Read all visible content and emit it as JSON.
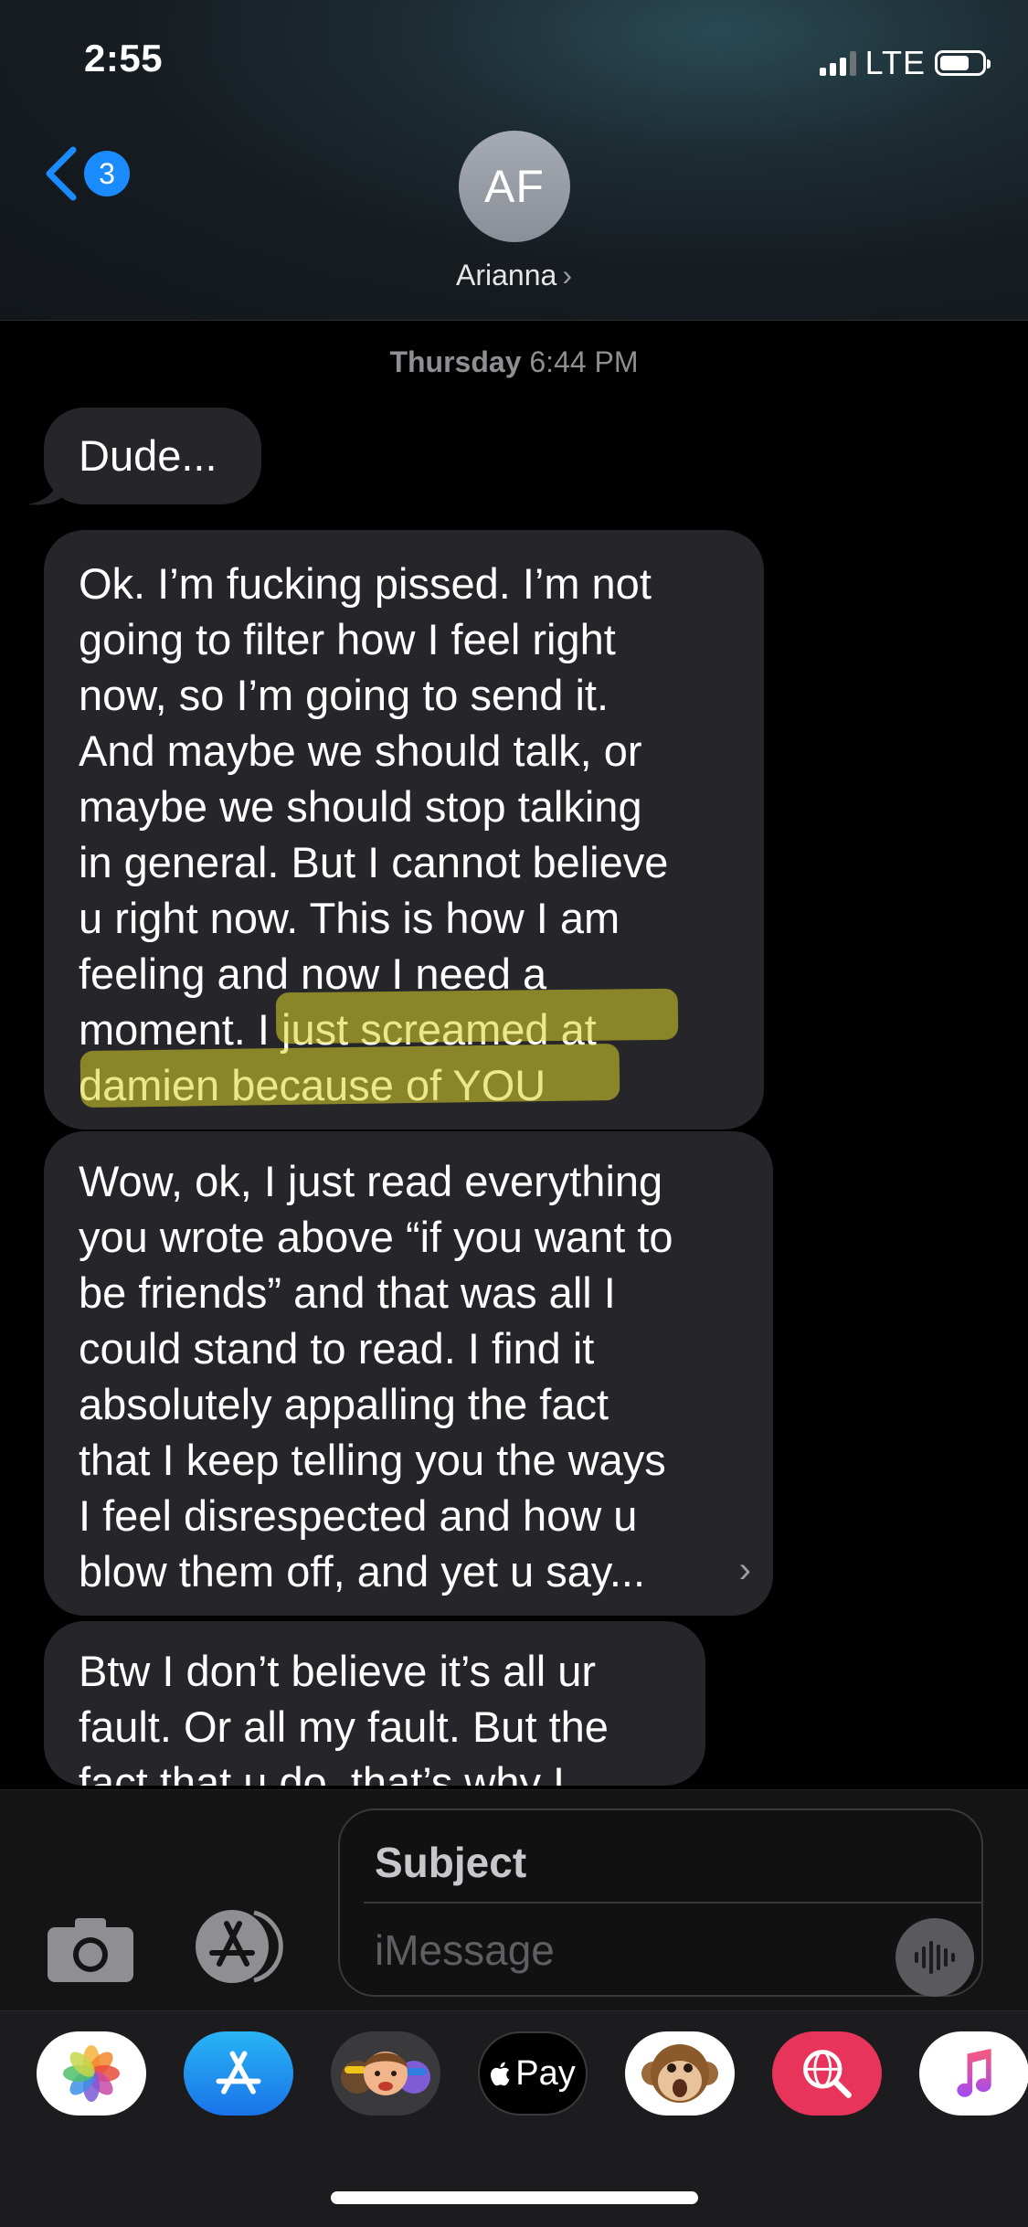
{
  "status": {
    "time": "2:55",
    "network": "LTE"
  },
  "nav": {
    "unread_count": "3",
    "avatar_initials": "AF",
    "contact_name": "Arianna"
  },
  "conversation": {
    "timestamp_day": "Thursday",
    "timestamp_time": "6:44 PM",
    "messages": [
      {
        "lines": [
          "Dude..."
        ]
      },
      {
        "lines": [
          "Ok. I’m fucking pissed. I’m not",
          "going to filter how I feel right",
          "now, so I’m going to send it.",
          "And maybe we should talk, or",
          "maybe we should stop talking",
          "in general. But I cannot believe",
          "u right now. This is how I am",
          "feeling and now I need a",
          "moment. I just screamed at",
          "damien because of YOU"
        ]
      },
      {
        "lines": [
          "Wow, ok, I just read everything",
          "you wrote above “if you want to",
          "be friends” and that was all I",
          "could stand to read. I find it",
          "absolutely appalling the fact",
          "that I keep telling you the ways",
          "I feel disrespected and how u",
          "blow them off, and yet u say..."
        ]
      },
      {
        "lines": [
          "Btw I don’t believe it’s all ur",
          "fault. Or all my fault. But the",
          "fact that u do, that’s why I"
        ]
      }
    ]
  },
  "compose": {
    "subject_placeholder": "Subject",
    "message_placeholder": "iMessage"
  },
  "drawer": {
    "apps": [
      "photos-app",
      "app-store-app",
      "memoji-stickers-app",
      "apple-pay-app",
      "animoji-app",
      "image-search-app",
      "music-app"
    ],
    "apple_pay_label": "Pay"
  }
}
